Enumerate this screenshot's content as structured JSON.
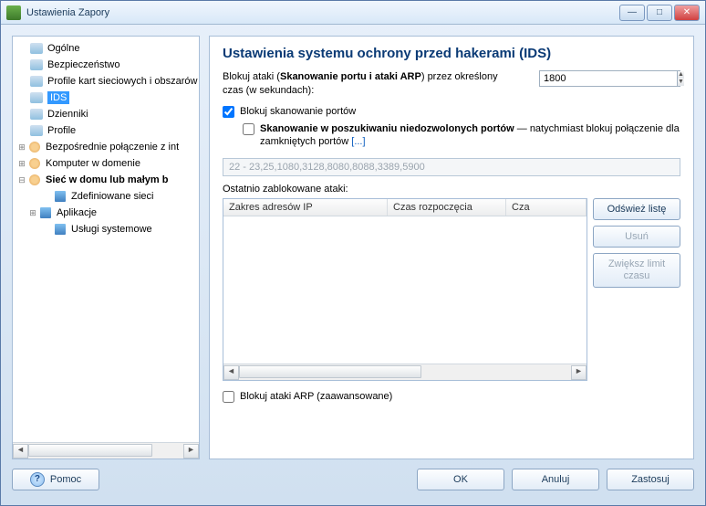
{
  "window": {
    "title": "Ustawienia Zapory"
  },
  "tree": {
    "items": [
      {
        "label": "Ogólne"
      },
      {
        "label": "Bezpieczeństwo"
      },
      {
        "label": "Profile kart sieciowych i obszarów"
      },
      {
        "label": "IDS",
        "sel": true
      },
      {
        "label": "Dzienniki"
      },
      {
        "label": "Profile"
      },
      {
        "label": "Bezpośrednie połączenie z int"
      },
      {
        "label": "Komputer w domenie"
      },
      {
        "label": "Sieć w domu lub małym b"
      },
      {
        "label": "Zdefiniowane sieci"
      },
      {
        "label": "Aplikacje"
      },
      {
        "label": "Usługi systemowe"
      }
    ]
  },
  "main": {
    "heading": "Ustawienia systemu ochrony przed hakerami (IDS)",
    "block_pre": "Blokuj ataki (",
    "block_bold": "Skanowanie portu i ataki ARP",
    "block_post": ") przez określony czas (w sekundach):",
    "timeout_value": "1800",
    "cb1_label": "Blokuj skanowanie portów",
    "cb2_bold": "Skanowanie w poszukiwaniu niedozwolonych portów",
    "cb2_rest": " — natychmiast blokuj połączenie dla zamkniętych portów ",
    "cb2_link": "[...]",
    "ports_value": "22 - 23,25,1080,3128,8080,8088,3389,5900",
    "recent_label": "Ostatnio zablokowane ataki:",
    "th1": "Zakres adresów IP",
    "th2": "Czas rozpoczęcia",
    "th3": "Cza",
    "buttons": {
      "refresh": "Odśwież listę",
      "delete": "Usuń",
      "increase": "Zwiększ limit czasu"
    },
    "cb3_label": "Blokuj ataki ARP (zaawansowane)"
  },
  "footer": {
    "help": "Pomoc",
    "ok": "OK",
    "cancel": "Anuluj",
    "apply": "Zastosuj"
  }
}
